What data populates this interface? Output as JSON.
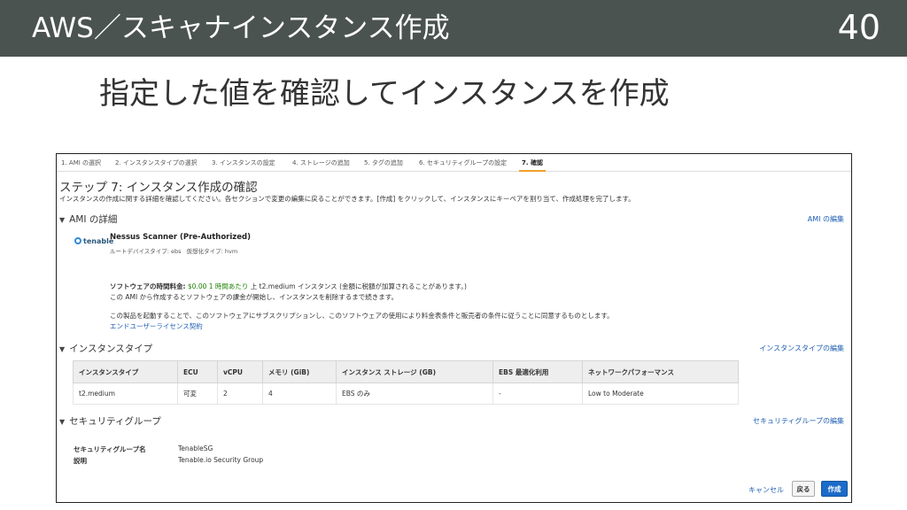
{
  "slide": {
    "title": "AWS／スキャナインスタンス作成",
    "number": "40",
    "subtitle": "指定した値を確認してインスタンスを作成"
  },
  "wizard": {
    "steps": [
      "1. AMI の選択",
      "2. インスタンスタイプの選択",
      "3. インスタンスの設定",
      "4. ストレージの追加",
      "5. タグの追加",
      "6. セキュリティグループの設定",
      "7. 確認"
    ],
    "active_index": 6,
    "title": "ステップ 7: インスタンス作成の確認",
    "description": "インスタンスの作成に関する詳細を確認してください。各セクションで変更の編集に戻ることができます。[作成] をクリックして、インスタンスにキーペアを割り当て、作成処理を完了します。"
  },
  "ami": {
    "heading": "AMI の詳細",
    "edit_link": "AMI の編集",
    "vendor_logo": "tenable",
    "name": "Nessus Scanner (Pre-Authorized)",
    "root_device_label": "ルートデバイスタイプ: ebs",
    "virtualization_label": "仮想化タイプ: hvm",
    "pricing_label": "ソフトウェアの時間料金:",
    "pricing_value": "$0.00 1 時間あたり",
    "pricing_rest": "上 t2.medium インスタンス (金額に税額が加算されることがあります。)",
    "billing_note": "この AMI から作成するとソフトウェアの課金が開始し、インスタンスを削除するまで続きます。",
    "subscription_note": "この製品を起動することで、このソフトウェアにサブスクリプションし、このソフトウェアの使用により料金表条件と販売者の条件に従うことに同意するものとします。",
    "eula_link": "エンドユーザーライセンス契約"
  },
  "instance_type": {
    "heading": "インスタンスタイプ",
    "edit_link": "インスタンスタイプの編集",
    "columns": [
      "インスタンスタイプ",
      "ECU",
      "vCPU",
      "メモリ (GiB)",
      "インスタンス ストレージ (GB)",
      "EBS 最適化利用",
      "ネットワークパフォーマンス"
    ],
    "rows": [
      [
        "t2.medium",
        "可変",
        "2",
        "4",
        "EBS のみ",
        "-",
        "Low to Moderate"
      ]
    ]
  },
  "security_group": {
    "heading": "セキュリティグループ",
    "edit_link": "セキュリティグループの編集",
    "name_label": "セキュリティグループ名",
    "name_value": "TenableSG",
    "desc_label": "説明",
    "desc_value": "Tenable.io Security Group"
  },
  "footer": {
    "cancel": "キャンセル",
    "back": "戻る",
    "create": "作成"
  },
  "colors": {
    "header_bg": "#4b5350",
    "link": "#1f5fb3",
    "primary_button": "#1b6bc9",
    "active_tab_underline": "#f0a127",
    "price_green": "#1d8102"
  }
}
